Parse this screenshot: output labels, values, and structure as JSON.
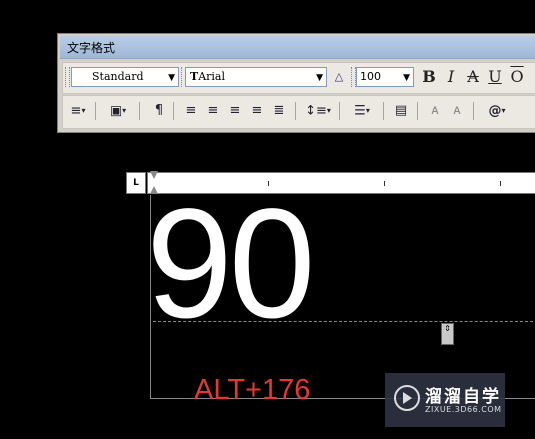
{
  "window": {
    "title": "文字格式"
  },
  "toolbar": {
    "style_value": "Standard",
    "font_value": "Arial",
    "font_prefix": "T",
    "height_value": "100",
    "bold_label": "B",
    "italic_label": "I",
    "strike_label": "A",
    "underline_label": "U",
    "overline_label": "O",
    "dropdown_glyph": "▾",
    "row2": {
      "paragraph_label": "¶",
      "insert_label": "@"
    }
  },
  "ruler": {
    "corner_label": "L"
  },
  "editor": {
    "text": "90",
    "resize_glyph": "⇕"
  },
  "annotation": {
    "text": "ALT+176",
    "color": "#e03a32"
  },
  "watermark": {
    "title": "溜溜自学",
    "url": "ZIXUE.3D66.COM"
  }
}
